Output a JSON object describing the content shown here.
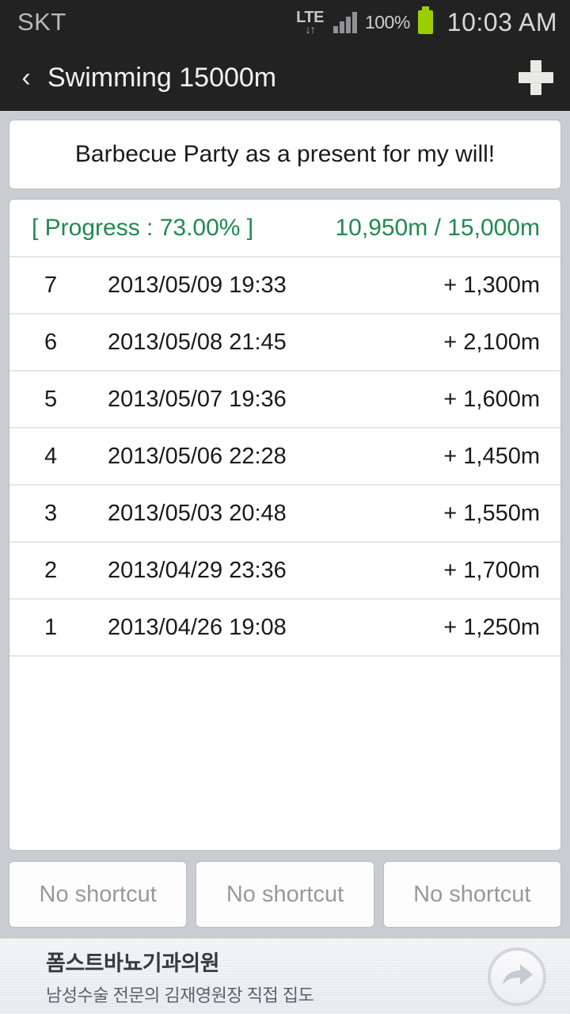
{
  "status_bar": {
    "carrier": "SKT",
    "network": "LTE",
    "network_arrows": "↓↑",
    "battery_percent": "100%",
    "time": "10:03 AM",
    "icons": [
      "lte-icon",
      "signal-bars-icon",
      "battery-icon"
    ],
    "colors": {
      "background": "#222222",
      "battery": "#9ccd00",
      "text": "#cfcfcf"
    }
  },
  "title_bar": {
    "back_icon": "‹",
    "title": "Swimming 15000m",
    "add_icon": "plus-icon"
  },
  "goal_card": {
    "text": "Barbecue Party as a present for my will!"
  },
  "summary": {
    "progress_label": "[ Progress : 73.00% ]",
    "progress_value": "10,950m / 15,000m",
    "percent": 73.0,
    "current": "10,950m",
    "target": "15,000m",
    "color": "#1f8a4f"
  },
  "log": {
    "rows": [
      {
        "index": "7",
        "date": "2013/05/09 19:33",
        "amount": "+ 1,300m"
      },
      {
        "index": "6",
        "date": "2013/05/08 21:45",
        "amount": "+ 2,100m"
      },
      {
        "index": "5",
        "date": "2013/05/07 19:36",
        "amount": "+ 1,600m"
      },
      {
        "index": "4",
        "date": "2013/05/06 22:28",
        "amount": "+ 1,450m"
      },
      {
        "index": "3",
        "date": "2013/05/03 20:48",
        "amount": "+ 1,550m"
      },
      {
        "index": "2",
        "date": "2013/04/29 23:36",
        "amount": "+ 1,700m"
      },
      {
        "index": "1",
        "date": "2013/04/26 19:08",
        "amount": "+ 1,250m"
      }
    ]
  },
  "shortcuts": [
    {
      "label": "No shortcut"
    },
    {
      "label": "No shortcut"
    },
    {
      "label": "No shortcut"
    }
  ],
  "ad": {
    "title": "폼스트바뇨기과의원",
    "subtitle": "남성수술 전문의 김재영원장 직접 집도",
    "arrow_icon": "share-arrow-icon"
  }
}
